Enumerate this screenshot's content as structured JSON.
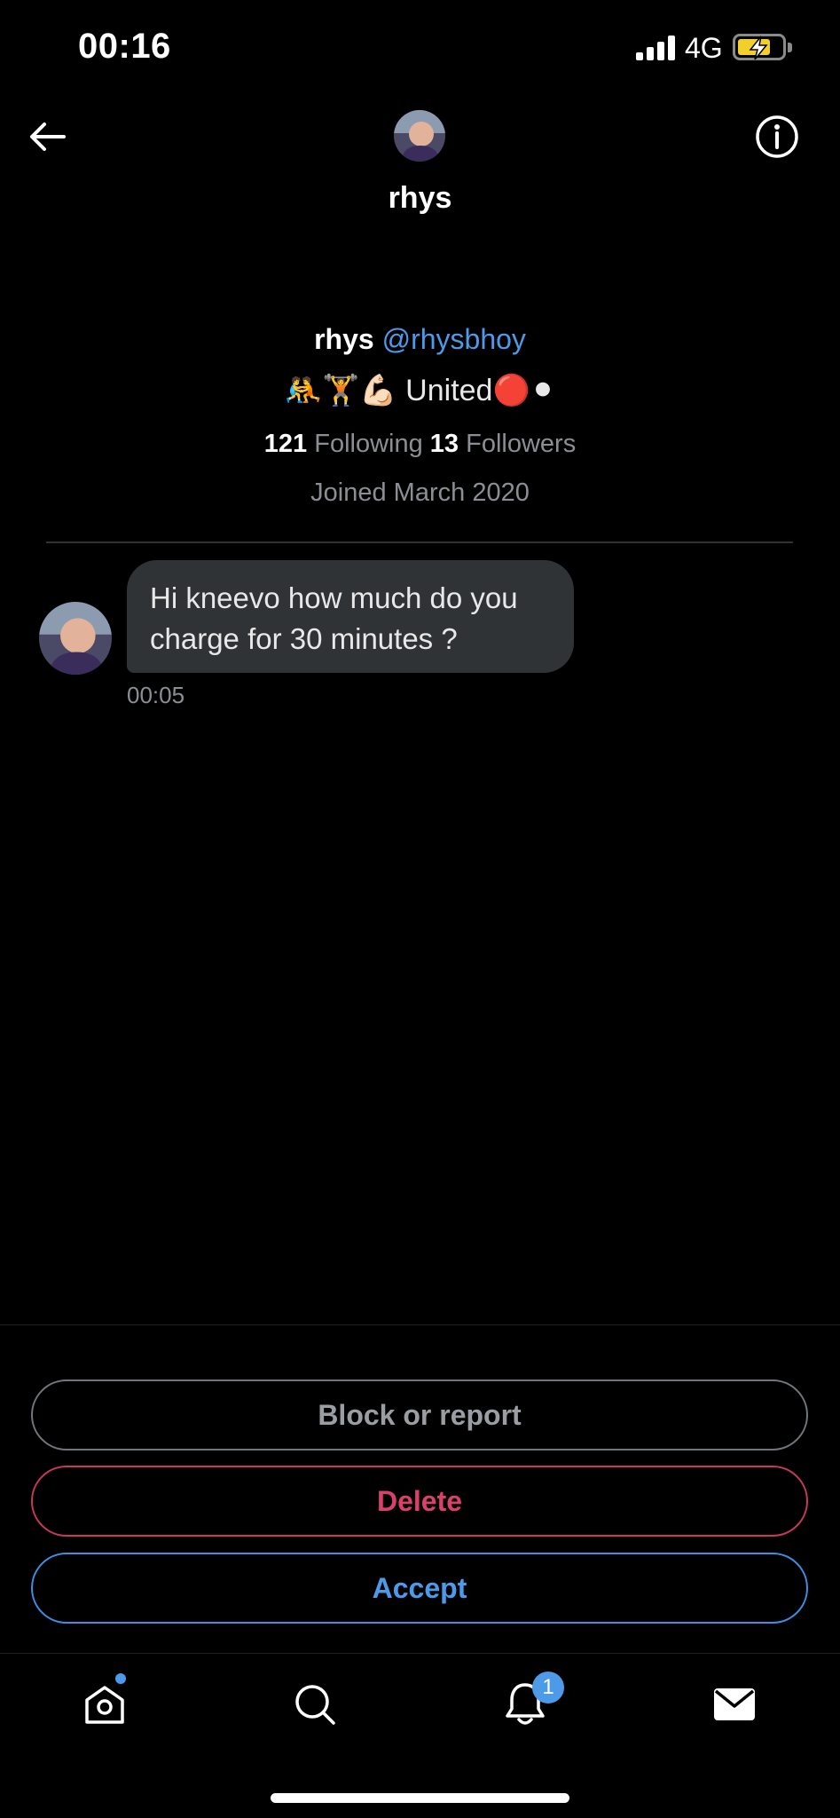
{
  "status_bar": {
    "time": "00:16",
    "network": "4G"
  },
  "header": {
    "title": "rhys",
    "back_icon": "arrow-left-icon",
    "info_icon": "info-circle-icon"
  },
  "profile": {
    "name": "rhys",
    "handle": "@rhysbhoy",
    "bio_emojis": "🤼🏋💪🏻",
    "bio_text": "United",
    "bio_trailing_emojis": "🔴⚫",
    "following_count": "121",
    "following_label": "Following",
    "followers_count": "13",
    "followers_label": "Followers",
    "joined": "Joined March 2020"
  },
  "message": {
    "text": "Hi kneevo how much do you charge for 30 minutes ?",
    "time": "00:05"
  },
  "actions": {
    "block_label": "Block or report",
    "delete_label": "Delete",
    "accept_label": "Accept"
  },
  "tab_bar": {
    "items": [
      {
        "name": "home",
        "icon": "home-icon"
      },
      {
        "name": "search",
        "icon": "search-icon"
      },
      {
        "name": "notifications",
        "icon": "bell-icon"
      },
      {
        "name": "messages",
        "icon": "mail-icon"
      }
    ],
    "notifications_badge": "1"
  },
  "colors": {
    "background": "#000000",
    "accent": "#4c9ae8",
    "delete": "#d9416b",
    "bubble": "#2f3336",
    "muted": "#8b8f94"
  }
}
